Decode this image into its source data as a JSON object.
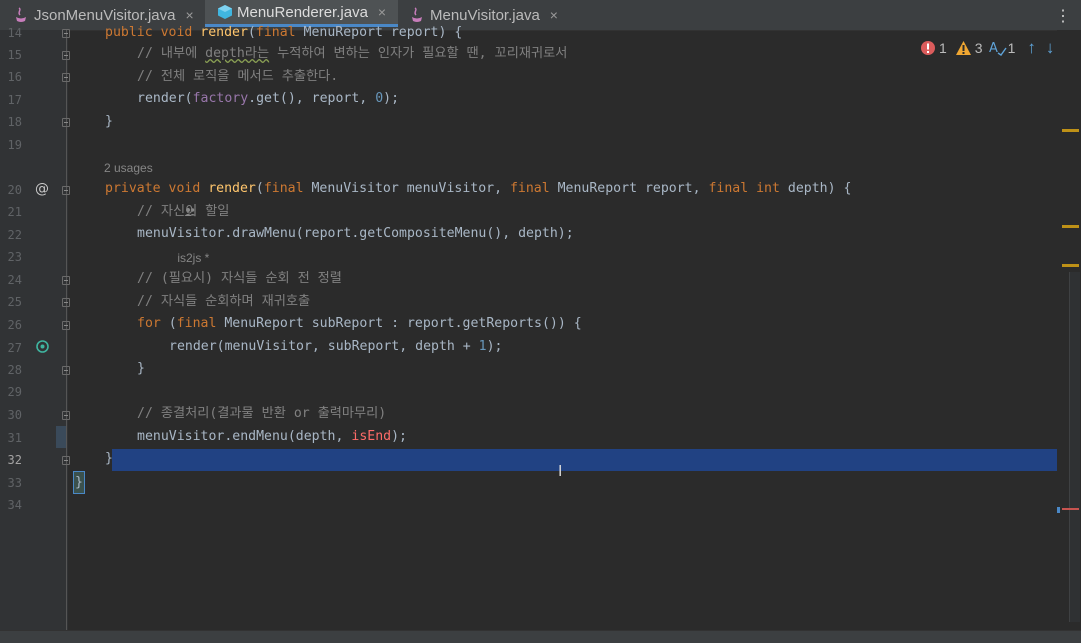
{
  "tabs": [
    {
      "label": "JsonMenuVisitor.java",
      "icon": "java-file-icon",
      "close": "×",
      "active": false
    },
    {
      "label": "MenuRenderer.java",
      "icon": "class-file-icon",
      "close": "×",
      "active": true
    },
    {
      "label": "MenuVisitor.java",
      "icon": "java-file-icon",
      "close": "×",
      "active": false
    }
  ],
  "tab_menu_glyph": "⋮",
  "inspections": {
    "errors": "1",
    "warnings": "3",
    "typos": "1",
    "up_glyph": "↑",
    "down_glyph": "↓"
  },
  "line_numbers": [
    "14",
    "15",
    "16",
    "17",
    "18",
    "19",
    "",
    "20",
    "21",
    "22",
    "23",
    "24",
    "25",
    "26",
    "27",
    "28",
    "29",
    "30",
    "31",
    "32",
    "33",
    "34"
  ],
  "current_line": "32",
  "codelens": {
    "usages": "2 usages",
    "author": "is2js *"
  },
  "gutter_icons": {
    "override": "@",
    "recursion": "↻"
  },
  "code": {
    "l14": {
      "kw1": "public ",
      "kw2": "void ",
      "fn": "render",
      "p1": "(",
      "kw3": "final ",
      "t1": "MenuReport report) {"
    },
    "l15": "// 내부에 depth라는 누적하여 변하는 인자가 필요할 땐, 꼬리재귀로서",
    "l15_underlined": "depth라는",
    "l16": "// 전체 로직을 메서드 추출한다.",
    "l17": {
      "a": "render(",
      "fld": "factory",
      "b": ".get(), report, ",
      "num": "0",
      "c": ");"
    },
    "l18": "}",
    "l20": {
      "kw1": "private ",
      "kw2": "void ",
      "fn": "render",
      "p1": "(",
      "kw3": "final ",
      "t1": "MenuVisitor menuVisitor, ",
      "kw4": "final ",
      "t2": "MenuReport report, ",
      "kw5": "final ",
      "kw6": "int ",
      "t3": "depth) {"
    },
    "l21": "// 자신이 할일",
    "l22": "menuVisitor.drawMenu(report.getCompositeMenu(), depth);",
    "l24": "// (필요시) 자식들 순회 전 정렬",
    "l25": "// 자식들 순회하며 재귀호출",
    "l26": {
      "kw1": "for ",
      "p": "(",
      "kw2": "final ",
      "t": "MenuReport subReport : report.getReports()) {"
    },
    "l27": {
      "a": "render(menuVisitor, subReport, depth + ",
      "num": "1",
      "b": ");"
    },
    "l28": "}",
    "l30": "// 종결처리(결과물 반환 or 출력마무리)",
    "l31": {
      "a": "menuVisitor.endMenu(depth, ",
      "err": "isEnd",
      "b": ");"
    },
    "l32": "}",
    "l33": "}"
  },
  "colors": {
    "keyword": "#cc7832",
    "function": "#ffc66d",
    "comment": "#808080",
    "number": "#6897bb",
    "field": "#9876aa",
    "error": "#ff6b68",
    "selection": "#214283",
    "accent": "#4a88c7"
  }
}
